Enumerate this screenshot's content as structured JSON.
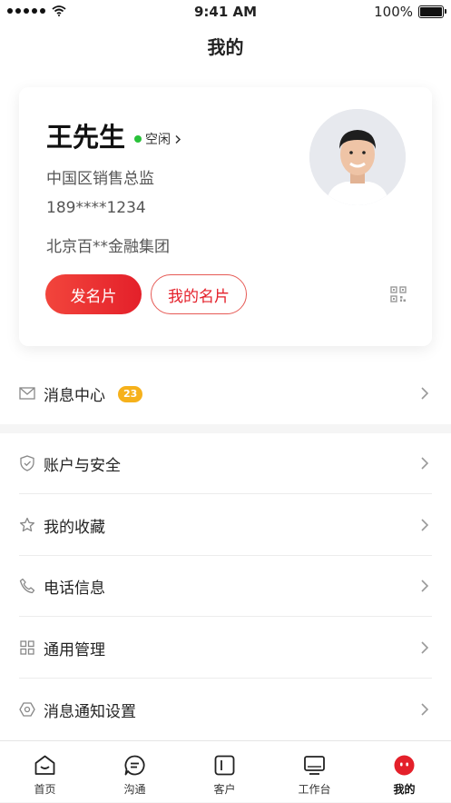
{
  "status_bar": {
    "time": "9:41 AM",
    "battery": "100%"
  },
  "page_title": "我的",
  "profile": {
    "name": "王先生",
    "status": "空闲",
    "title": "中国区销售总监",
    "phone": "189****1234",
    "company": "北京百**金融集团",
    "send_card_label": "发名片",
    "my_card_label": "我的名片"
  },
  "message_center": {
    "label": "消息中心",
    "badge": "23"
  },
  "menu": [
    {
      "label": "账户与安全",
      "icon": "shield-icon"
    },
    {
      "label": "我的收藏",
      "icon": "star-icon"
    },
    {
      "label": "电话信息",
      "icon": "phone-icon"
    },
    {
      "label": "通用管理",
      "icon": "grid-icon"
    },
    {
      "label": "消息通知设置",
      "icon": "settings-icon"
    }
  ],
  "tabs": [
    {
      "label": "首页",
      "icon": "home-icon"
    },
    {
      "label": "沟通",
      "icon": "chat-icon"
    },
    {
      "label": "客户",
      "icon": "customer-icon"
    },
    {
      "label": "工作台",
      "icon": "workbench-icon"
    },
    {
      "label": "我的",
      "icon": "profile-icon",
      "active": true
    }
  ],
  "colors": {
    "accent": "#e4202a",
    "badge": "#f6b11b",
    "online": "#29c23a"
  }
}
